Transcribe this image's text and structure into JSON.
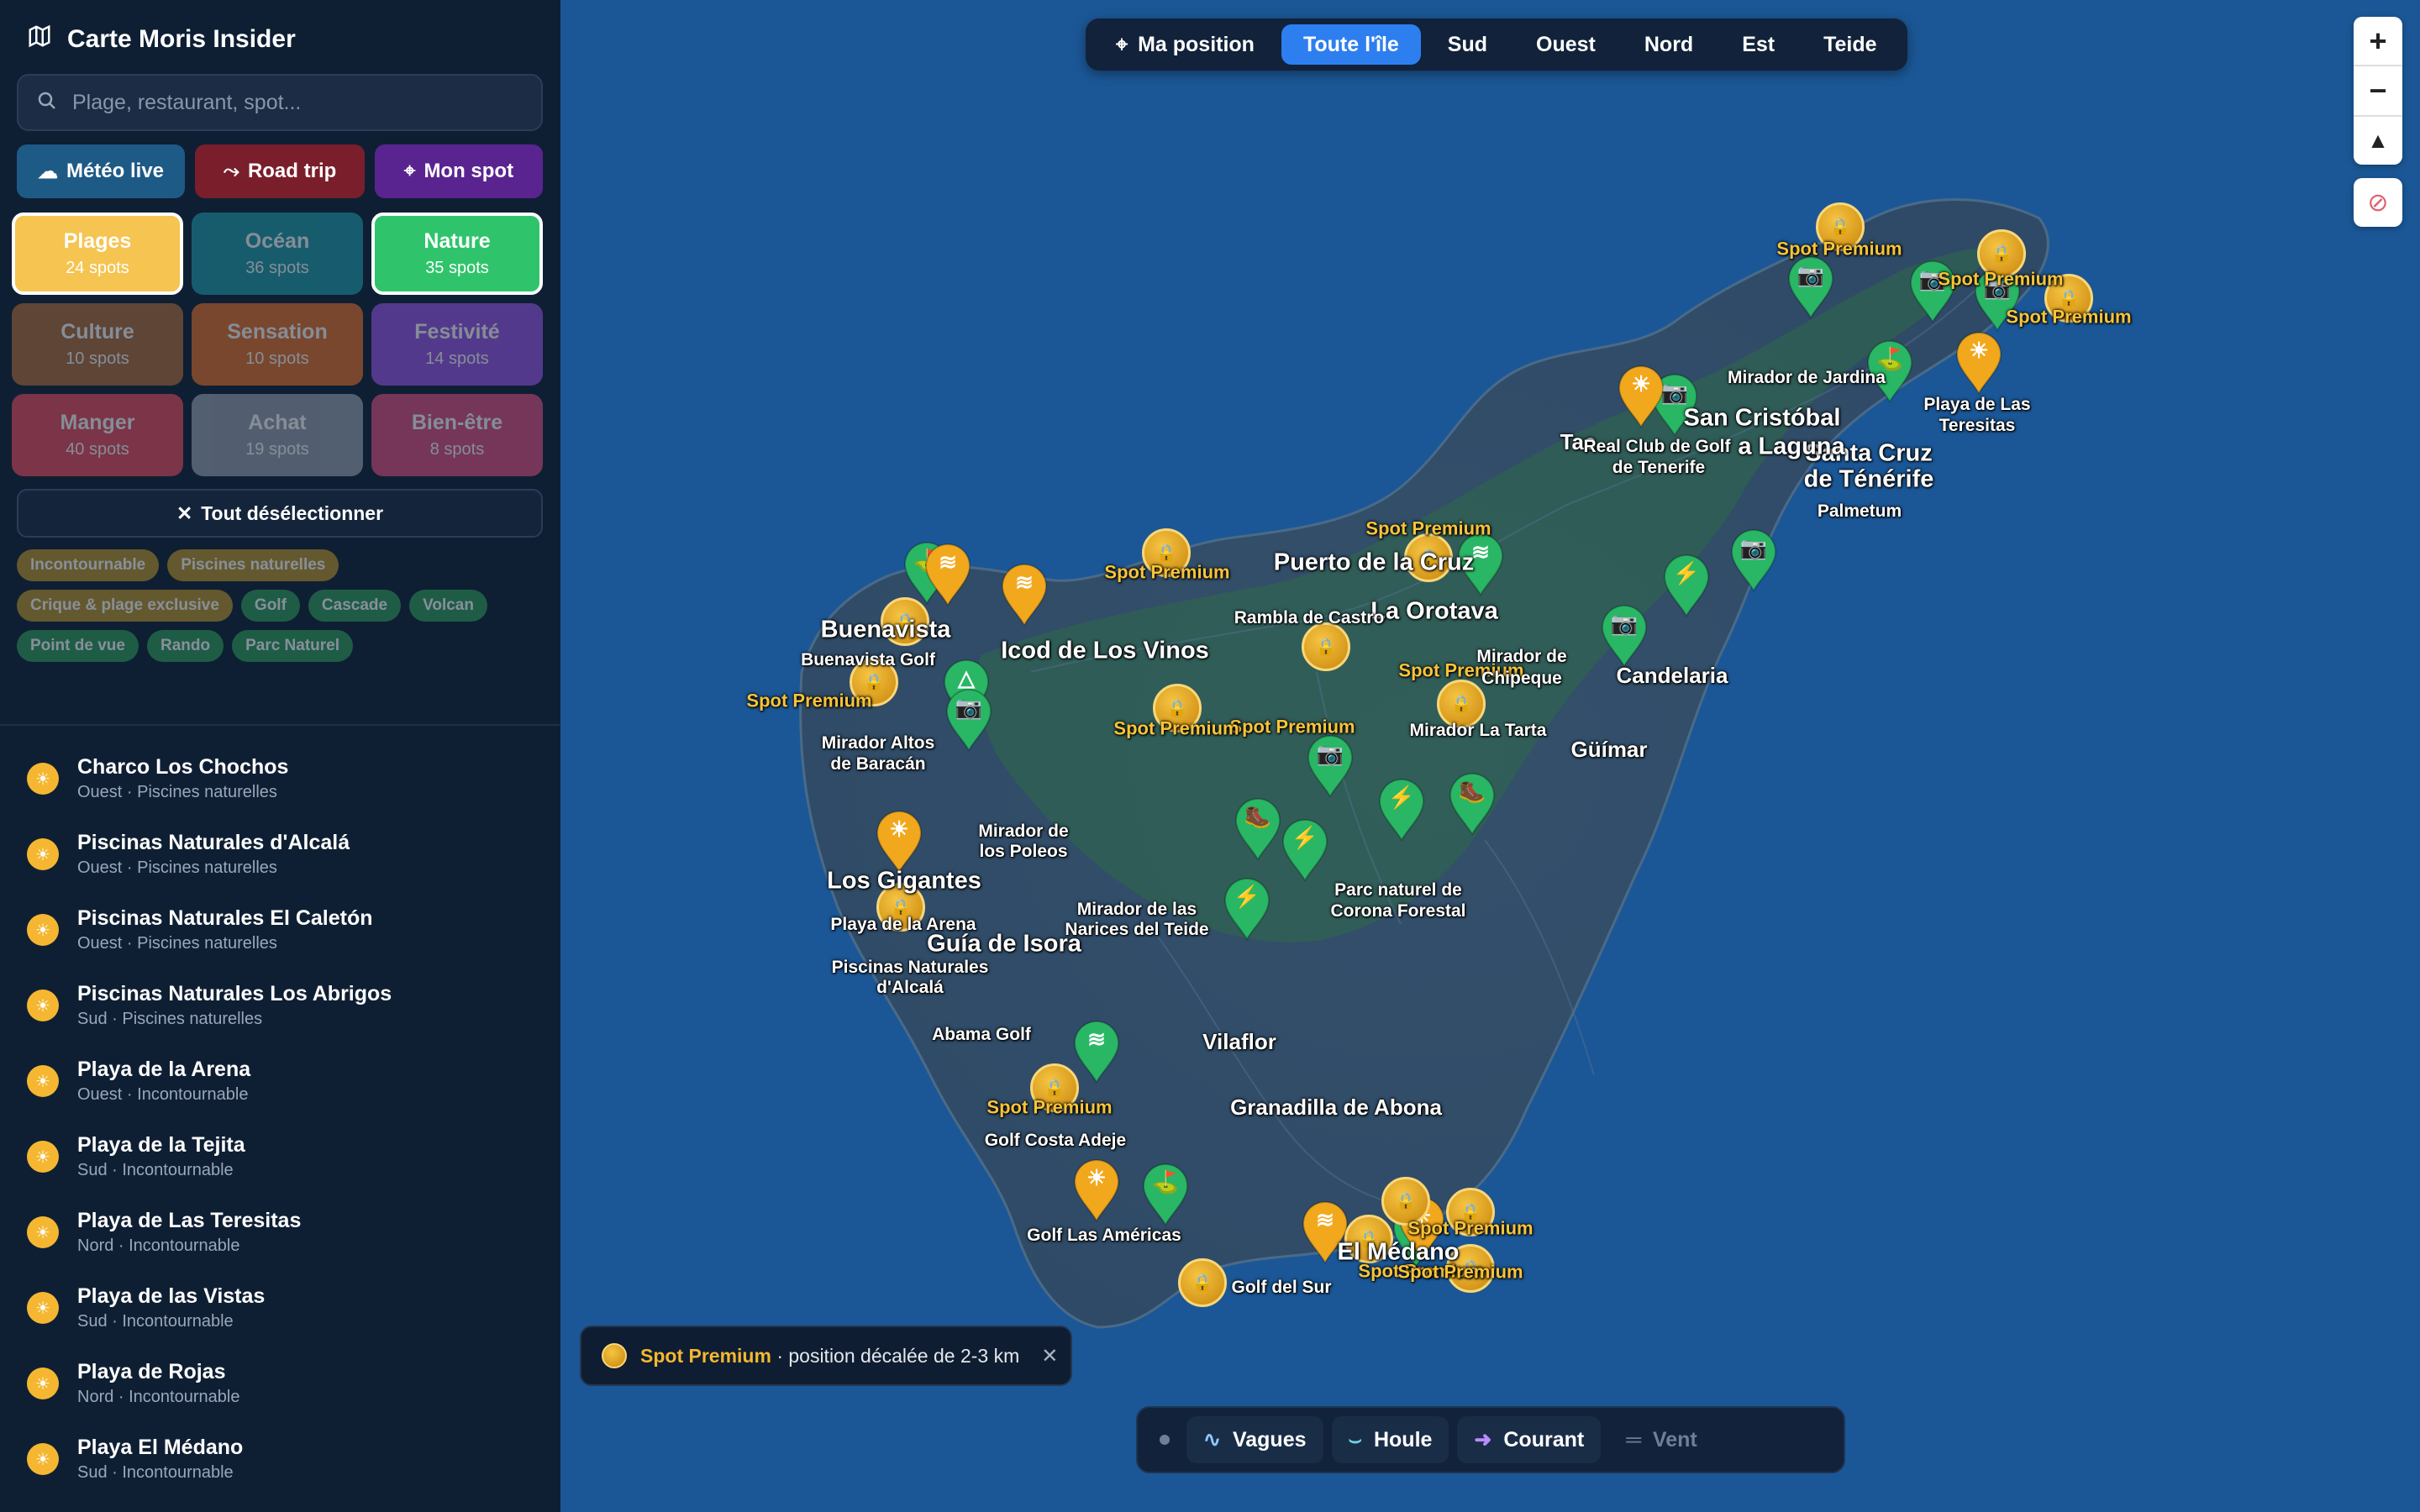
{
  "app": {
    "title": "Carte Moris Insider"
  },
  "search": {
    "placeholder": "Plage, restaurant, spot..."
  },
  "actions": [
    {
      "label": "Météo live",
      "color": "#1e5a86"
    },
    {
      "label": "Road trip",
      "color": "#7a1e2c"
    },
    {
      "label": "Mon spot",
      "color": "#5a2490"
    }
  ],
  "categories": [
    {
      "label": "Plages",
      "count": "24 spots",
      "color": "#f5c451",
      "active": true
    },
    {
      "label": "Océan",
      "count": "36 spots",
      "color": "#1f8e9e",
      "active": false
    },
    {
      "label": "Nature",
      "count": "35 spots",
      "color": "#2fc46b",
      "active": true
    },
    {
      "label": "Culture",
      "count": "10 spots",
      "color": "#a0643a",
      "active": false
    },
    {
      "label": "Sensation",
      "count": "10 spots",
      "color": "#d0682a",
      "active": false
    },
    {
      "label": "Festivité",
      "count": "14 spots",
      "color": "#8b4fd6",
      "active": false
    },
    {
      "label": "Manger",
      "count": "40 spots",
      "color": "#d4465a",
      "active": false
    },
    {
      "label": "Achat",
      "count": "19 spots",
      "color": "#8a93a3",
      "active": false
    },
    {
      "label": "Bien-être",
      "count": "8 spots",
      "color": "#c94a7a",
      "active": false
    }
  ],
  "clear": {
    "label": "Tout désélectionner"
  },
  "tags": [
    {
      "label": "Incontournable",
      "color": "#b8912a"
    },
    {
      "label": "Piscines naturelles",
      "color": "#b8912a"
    },
    {
      "label": "Crique & plage exclusive",
      "color": "#b8912a"
    },
    {
      "label": "Golf",
      "color": "#2e9a5a"
    },
    {
      "label": "Cascade",
      "color": "#2e9a5a"
    },
    {
      "label": "Volcan",
      "color": "#2e9a5a"
    },
    {
      "label": "Point de vue",
      "color": "#2e9a5a"
    },
    {
      "label": "Rando",
      "color": "#2e9a5a"
    },
    {
      "label": "Parc Naturel",
      "color": "#2e9a5a"
    }
  ],
  "list": [
    {
      "name": "Charco Los Chochos",
      "sub": "Ouest · Piscines naturelles"
    },
    {
      "name": "Piscinas Naturales d'Alcalá",
      "sub": "Ouest · Piscines naturelles"
    },
    {
      "name": "Piscinas Naturales El Caletón",
      "sub": "Ouest · Piscines naturelles"
    },
    {
      "name": "Piscinas Naturales Los Abrigos",
      "sub": "Sud · Piscines naturelles"
    },
    {
      "name": "Playa de la Arena",
      "sub": "Ouest · Incontournable"
    },
    {
      "name": "Playa de la Tejita",
      "sub": "Sud · Incontournable"
    },
    {
      "name": "Playa de Las Teresitas",
      "sub": "Nord · Incontournable"
    },
    {
      "name": "Playa de las Vistas",
      "sub": "Sud · Incontournable"
    },
    {
      "name": "Playa de Rojas",
      "sub": "Nord · Incontournable"
    },
    {
      "name": "Playa El Médano",
      "sub": "Sud · Incontournable"
    }
  ],
  "topbar": {
    "position": "Ma position",
    "regions": [
      "Toute l'île",
      "Sud",
      "Ouest",
      "Nord",
      "Est",
      "Teide"
    ]
  },
  "premium_note": {
    "title": "Spot Premium",
    "text": "· position décalée de 2-3 km"
  },
  "layers": [
    "Vagues",
    "Houle",
    "Courant",
    "Vent"
  ],
  "map_labels": {
    "premium": "Spot Premium",
    "towns": [
      "San Cristóbal",
      "Santa Cruz",
      "de Ténérife",
      "Puerto de la Cruz",
      "La Orotava",
      "Icod de Los Vinos",
      "Buenavista",
      "Candelaria",
      "Güímar",
      "Los Gigantes",
      "Guía de Isora",
      "Vilaflor",
      "Granadilla de Abona",
      "El Médano",
      "Tac"
    ],
    "places": [
      "Mirador de Jardina",
      "Real Club de Golf",
      "de Tenerife",
      "Playa de Las",
      "Teresitas",
      "Palmetum",
      "Rambla de Castro",
      "Mirador de",
      "Chipeque",
      "Mirador La Tarta",
      "Buenavista Golf",
      "Mirador Altos",
      "de Baracán",
      "Mirador de",
      "los Poleos",
      "Mirador de las",
      "Narices del Teide",
      "Parc naturel de",
      "Corona Forestal",
      "Playa de la Arena",
      "Piscinas Naturales",
      "d'Alcalá",
      "Abama Golf",
      "Golf Costa Adeje",
      "Golf Las Américas",
      "Golf del Sur",
      "a Laguna"
    ]
  }
}
